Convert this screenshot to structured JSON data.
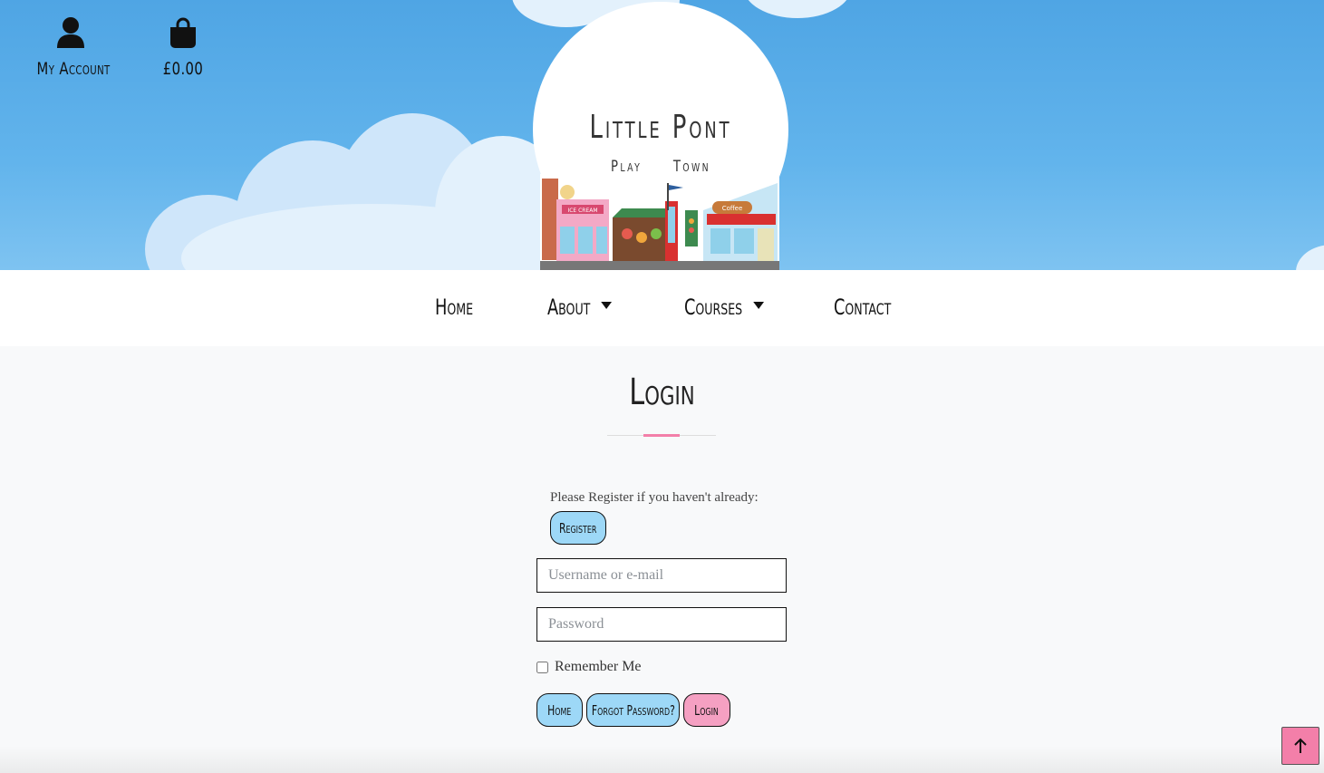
{
  "header": {
    "account_label": "My Account",
    "account_icon": "user-icon",
    "basket_total": "£0.00",
    "basket_icon": "shopping-bag-icon",
    "logo": {
      "title": "Little Pont",
      "subtitle": "Play Town",
      "signs": [
        "ICE CREAM",
        "Coffee"
      ]
    }
  },
  "nav": {
    "items": [
      {
        "label": "Home",
        "dropdown": false
      },
      {
        "label": "About",
        "dropdown": true
      },
      {
        "label": "Courses",
        "dropdown": true
      },
      {
        "label": "Contact",
        "dropdown": false
      }
    ]
  },
  "page": {
    "title": "Login",
    "register_prompt": "Please Register if you haven't already:",
    "register_button": "Register",
    "username_placeholder": "Username or e-mail",
    "password_placeholder": "Password",
    "remember_label": "Remember Me",
    "buttons": {
      "home": "Home",
      "forgot": "Forgot Password?",
      "login": "Login"
    }
  },
  "colors": {
    "sky": "#4fa5e4",
    "button_blue": "#9dd8f7",
    "button_pink": "#f5a0c2",
    "accent": "#f37fa9"
  },
  "back_to_top_icon": "arrow-up-icon"
}
